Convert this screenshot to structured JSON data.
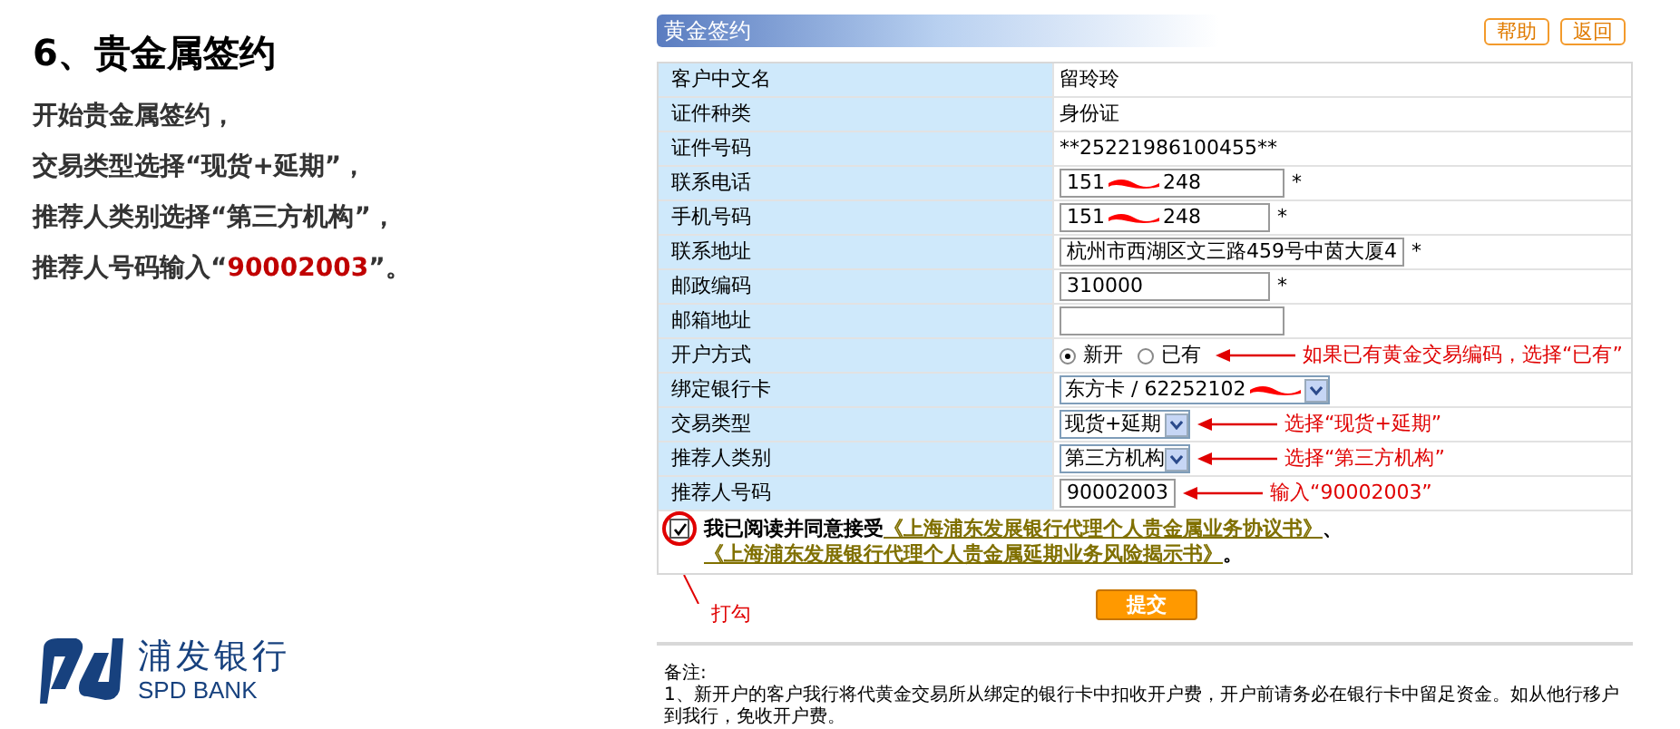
{
  "slide": {
    "title": "6、贵金属签约",
    "lines": [
      {
        "parts": [
          {
            "text": "开始贵金属签约，",
            "highlight": false
          }
        ]
      },
      {
        "parts": [
          {
            "text": "交易类型选择“现货+延期”，",
            "highlight": false
          }
        ]
      },
      {
        "parts": [
          {
            "text": "推荐人类别选择“第三方机构”，",
            "highlight": false
          }
        ]
      },
      {
        "parts": [
          {
            "text": "推荐人号码输入“",
            "highlight": false
          },
          {
            "text": "90002003",
            "highlight": true
          },
          {
            "text": "”。",
            "highlight": false
          }
        ]
      }
    ]
  },
  "logo": {
    "name": "浦发银行",
    "english": "SPD BANK"
  },
  "panel": {
    "title": "黄金签约",
    "buttons": [
      "帮助",
      "返回"
    ]
  },
  "rows": [
    {
      "kind": "text",
      "label": "客户中文名",
      "value": "留玲玲"
    },
    {
      "kind": "text",
      "label": "证件种类",
      "value": "身份证"
    },
    {
      "kind": "text",
      "label": "证件号码",
      "value": "**25221986100455**"
    },
    {
      "kind": "input",
      "label": "联系电话",
      "value": "151",
      "redacted": true,
      "value_end": "248",
      "required_mark": "*"
    },
    {
      "kind": "input",
      "label": "手机号码",
      "value": "151",
      "redacted": true,
      "value_end": "248",
      "required_mark": "*"
    },
    {
      "kind": "input",
      "label": "联系地址",
      "value": "杭州市西湖区文三路459号中茵大厦4",
      "required_mark": "*"
    },
    {
      "kind": "input",
      "label": "邮政编码",
      "value": "310000",
      "required_mark": "*"
    },
    {
      "kind": "input",
      "label": "邮箱地址"
    },
    {
      "kind": "radio",
      "label": "开户方式",
      "options": [
        {
          "label": "新开",
          "selected": true
        },
        {
          "label": "已有",
          "selected": false
        }
      ],
      "annotation": "如果已有黄金交易编码，选择“已有”"
    },
    {
      "kind": "select",
      "label": "绑定银行卡",
      "value": "东方卡 / 62252102",
      "redacted": true
    },
    {
      "kind": "select",
      "label": "交易类型",
      "value": "现货+延期",
      "annotation": "选择“现货+延期”"
    },
    {
      "kind": "select",
      "label": "推荐人类别",
      "value": "第三方机构",
      "annotation": "选择“第三方机构”"
    },
    {
      "kind": "input",
      "label": "推荐人号码",
      "value": "90002003",
      "annotation": "输入“90002003”"
    }
  ],
  "agreement": {
    "checked": true,
    "text": "我已阅读并同意接受",
    "links": [
      "《上海浦东发展银行代理个人贵金属业务协议书》",
      "《上海浦东发展银行代理个人贵金属延期业务风险揭示书》"
    ],
    "separator": "、",
    "end": "。",
    "callout": "打勾"
  },
  "submit": "提交",
  "notes": {
    "heading": "备注:",
    "items": [
      "1、新开户的客户我行将代黄金交易所从绑定的银行卡中扣收开户费，开户前请务必在银行卡中留足资金。如从他行移户到我行，免收开户费。"
    ]
  }
}
